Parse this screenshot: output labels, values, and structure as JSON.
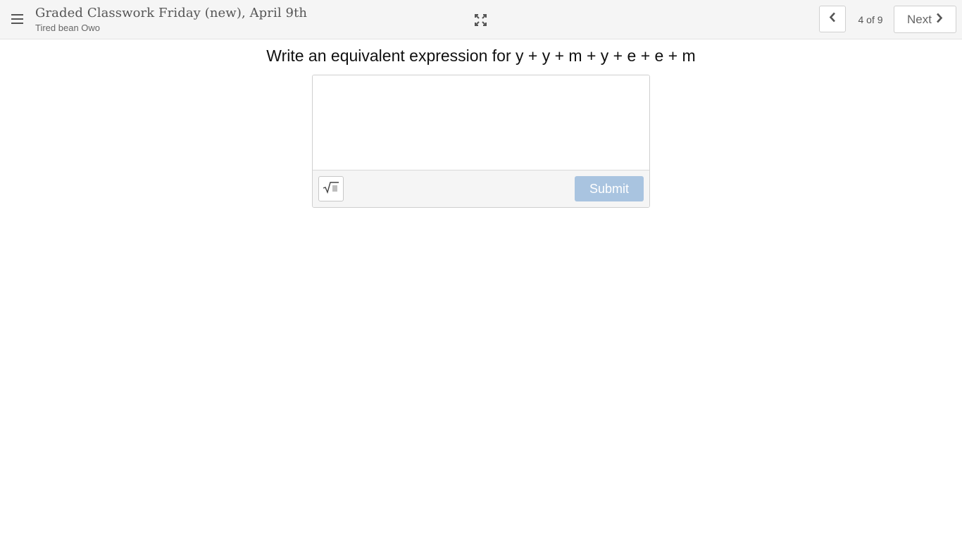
{
  "header": {
    "title": "Graded Classwork Friday (new), April 9th",
    "subtitle": "Tired bean Owo",
    "menu_icon": "hamburger-menu-icon",
    "fullscreen_icon": "expand-fullscreen-icon"
  },
  "pagination": {
    "prev_icon": "chevron-left-icon",
    "page_indicator": "4 of 9",
    "next_label": "Next",
    "next_icon": "chevron-right-icon"
  },
  "question": {
    "prompt": "Write an equivalent expression for y + y + m + y + e + e + m"
  },
  "answer": {
    "value": "",
    "math_button_icon": "square-root-icon",
    "submit_label": "Submit",
    "submit_enabled": false
  },
  "colors": {
    "header_bg": "#f5f5f5",
    "submit_disabled_bg": "#a9c4e0",
    "toolbar_bg": "#f5f5f5"
  }
}
